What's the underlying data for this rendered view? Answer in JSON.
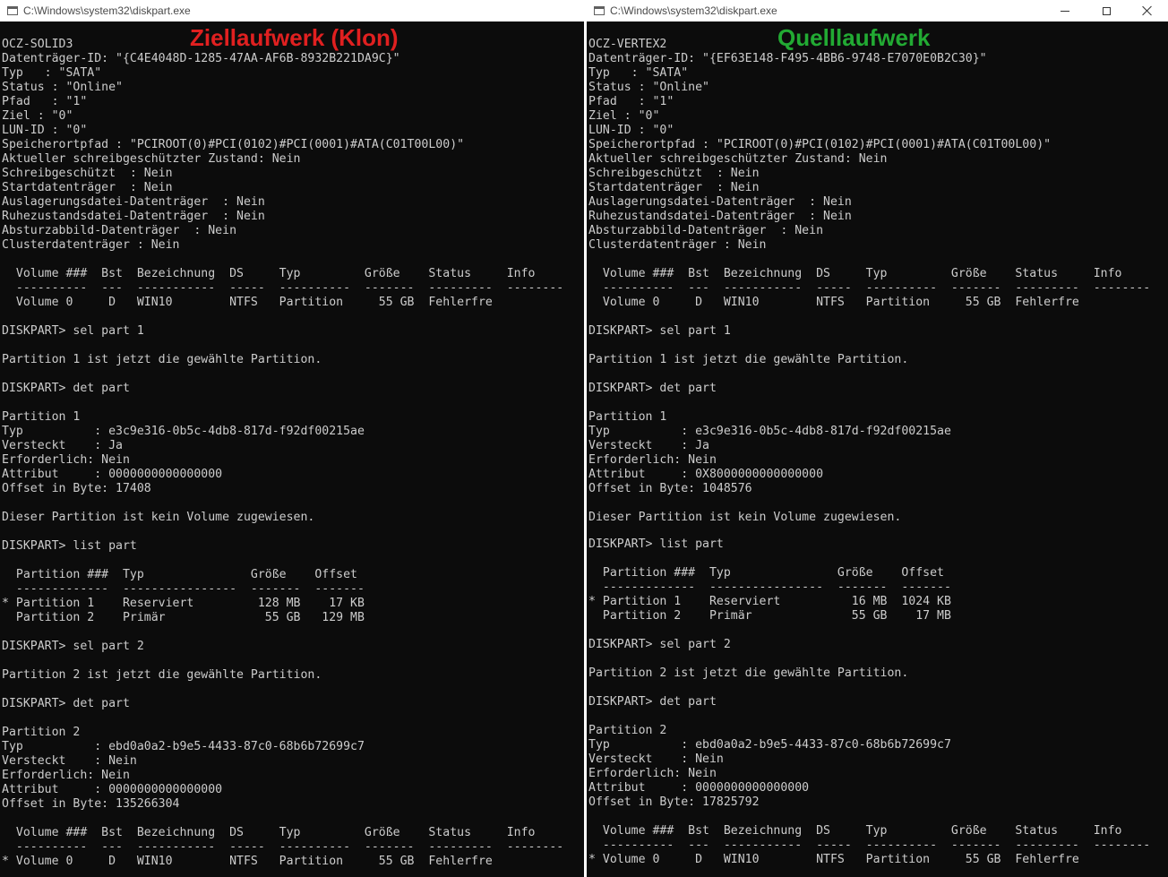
{
  "left_window": {
    "title": "C:\\Windows\\system32\\diskpart.exe",
    "lines": [
      "OCZ-SOLID3",
      "Datenträger-ID: \"{C4E4048D-1285-47AA-AF6B-8932B221DA9C}\"",
      "Typ   : \"SATA\"",
      "Status : \"Online\"",
      "Pfad   : \"1\"",
      "Ziel : \"0\"",
      "LUN-ID : \"0\"",
      "Speicherortpfad : \"PCIROOT(0)#PCI(0102)#PCI(0001)#ATA(C01T00L00)\"",
      "Aktueller schreibgeschützter Zustand: Nein",
      "Schreibgeschützt  : Nein",
      "Startdatenträger  : Nein",
      "Auslagerungsdatei-Datenträger  : Nein",
      "Ruhezustandsdatei-Datenträger  : Nein",
      "Absturzabbild-Datenträger  : Nein",
      "Clusterdatenträger : Nein",
      "",
      "  Volume ###  Bst  Bezeichnung  DS     Typ         Größe    Status     Info",
      "  ----------  ---  -----------  -----  ----------  -------  ---------  --------",
      "  Volume 0     D   WIN10        NTFS   Partition     55 GB  Fehlerfre",
      "",
      "DISKPART> sel part 1",
      "",
      "Partition 1 ist jetzt die gewählte Partition.",
      "",
      "DISKPART> det part",
      "",
      "Partition 1",
      "Typ          : e3c9e316-0b5c-4db8-817d-f92df00215ae",
      "Versteckt    : Ja",
      "Erforderlich: Nein",
      "Attribut     : 0000000000000000",
      "Offset in Byte: 17408",
      "",
      "Dieser Partition ist kein Volume zugewiesen.",
      "",
      "DISKPART> list part",
      "",
      "  Partition ###  Typ               Größe    Offset",
      "  -------------  ----------------  -------  -------",
      "* Partition 1    Reserviert         128 MB    17 KB",
      "  Partition 2    Primär              55 GB   129 MB",
      "",
      "DISKPART> sel part 2",
      "",
      "Partition 2 ist jetzt die gewählte Partition.",
      "",
      "DISKPART> det part",
      "",
      "Partition 2",
      "Typ          : ebd0a0a2-b9e5-4433-87c0-68b6b72699c7",
      "Versteckt    : Nein",
      "Erforderlich: Nein",
      "Attribut     : 0000000000000000",
      "Offset in Byte: 135266304",
      "",
      "  Volume ###  Bst  Bezeichnung  DS     Typ         Größe    Status     Info",
      "  ----------  ---  -----------  -----  ----------  -------  ---------  --------",
      "* Volume 0     D   WIN10        NTFS   Partition     55 GB  Fehlerfre"
    ]
  },
  "right_window": {
    "title": "C:\\Windows\\system32\\diskpart.exe",
    "lines_upper": [
      "OCZ-VERTEX2",
      "Datenträger-ID: \"{EF63E148-F495-4BB6-9748-E7070E0B2C30}\"",
      "Typ   : \"SATA\"",
      "Status : \"Online\"",
      "Pfad   : \"1\"",
      "Ziel : \"0\"",
      "LUN-ID : \"0\"",
      "Speicherortpfad : \"PCIROOT(0)#PCI(0102)#PCI(0001)#ATA(C01T00L00)\"",
      "Aktueller schreibgeschützter Zustand: Nein",
      "Schreibgeschützt  : Nein",
      "Startdatenträger  : Nein",
      "Auslagerungsdatei-Datenträger  : Nein",
      "Ruhezustandsdatei-Datenträger  : Nein",
      "Absturzabbild-Datenträger  : Nein",
      "Clusterdatenträger : Nein",
      "",
      "  Volume ###  Bst  Bezeichnung  DS     Typ         Größe    Status     Info",
      "  ----------  ---  -----------  -----  ----------  -------  ---------  --------",
      "  Volume 0     D   WIN10        NTFS   Partition     55 GB  Fehlerfre",
      "",
      "DISKPART> sel part 1",
      "",
      "Partition 1 ist jetzt die gewählte Partition.",
      "",
      "DISKPART> det part",
      "",
      "Partition 1",
      "Typ          : e3c9e316-0b5c-4db8-817d-f92df00215ae",
      "Versteckt    : Ja",
      "Erforderlich: Nein",
      "Attribut     : 0X8000000000000000",
      "Offset in Byte: 1048576",
      "",
      "Dieser Partition ist kein Volume zugewiesen.",
      ""
    ],
    "lines_lower": [
      "DISKPART> list part",
      "",
      "  Partition ###  Typ               Größe    Offset",
      "  -------------  ----------------  -------  -------",
      "* Partition 1    Reserviert          16 MB  1024 KB",
      "  Partition 2    Primär              55 GB    17 MB",
      "",
      "DISKPART> sel part 2",
      "",
      "Partition 2 ist jetzt die gewählte Partition.",
      "",
      "DISKPART> det part",
      "",
      "Partition 2",
      "Typ          : ebd0a0a2-b9e5-4433-87c0-68b6b72699c7",
      "Versteckt    : Nein",
      "Erforderlich: Nein",
      "Attribut     : 0000000000000000",
      "Offset in Byte: 17825792",
      "",
      "  Volume ###  Bst  Bezeichnung  DS     Typ         Größe    Status     Info",
      "  ----------  ---  -----------  -----  ----------  -------  ---------  --------",
      "* Volume 0     D   WIN10        NTFS   Partition     55 GB  Fehlerfre"
    ]
  },
  "overlay": {
    "left_label": "Ziellaufwerk (Klon)",
    "left_color": "#e02020",
    "right_label": "Quelllaufwerk",
    "right_color": "#22aa33"
  },
  "icons": {
    "app": "console-app-icon",
    "minimize": "minimize-icon",
    "maximize": "maximize-icon",
    "close": "close-icon"
  }
}
